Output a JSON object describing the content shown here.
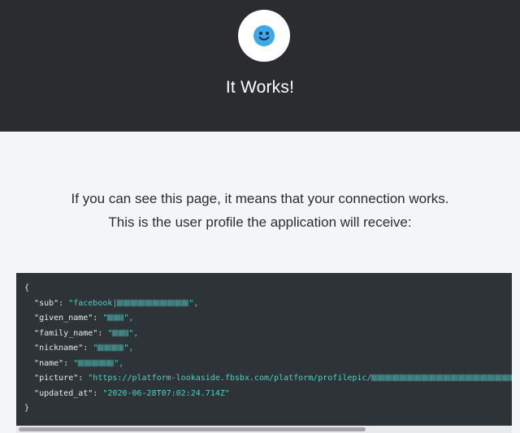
{
  "header": {
    "title": "It Works!",
    "avatar_icon": "smiley-face-icon",
    "avatar_color": "#3da9ea"
  },
  "intro": {
    "line1": "If you can see this page, it means that your connection works.",
    "line2": "This is the user profile the application will receive:"
  },
  "profile": {
    "open_brace": "{",
    "close_brace": "}",
    "fields": [
      {
        "key": "\"sub\"",
        "value_prefix": "\"facebook|",
        "value_suffix": "\","
      },
      {
        "key": "\"given_name\"",
        "value_prefix": "\"",
        "value_suffix": "\","
      },
      {
        "key": "\"family_name\"",
        "value_prefix": "\"",
        "value_suffix": "\","
      },
      {
        "key": "\"nickname\"",
        "value_prefix": "\"",
        "value_suffix": "\","
      },
      {
        "key": "\"name\"",
        "value_prefix": "\"",
        "value_suffix": "\","
      },
      {
        "key": "\"picture\"",
        "value_prefix": "\"https://platform-lookaside.fbsbx.com/platform/profilepic/",
        "value_suffix": ""
      },
      {
        "key": "\"updated_at\"",
        "value_prefix": "\"2020-06-28T07:02:24.714Z\"",
        "value_suffix": ""
      }
    ]
  },
  "colors": {
    "header_bg": "#2b2c30",
    "code_bg": "#2e3338",
    "string": "#49d3c5"
  }
}
